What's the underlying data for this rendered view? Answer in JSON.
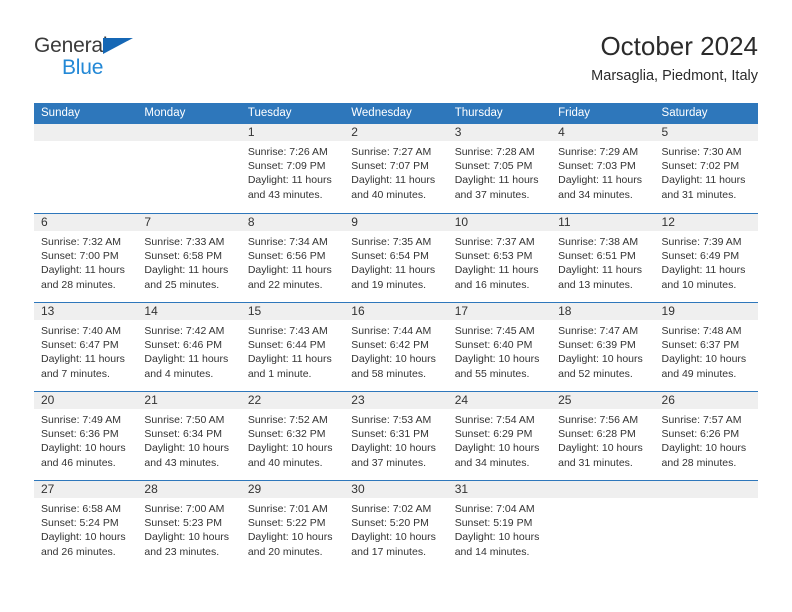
{
  "brand": {
    "name_part1": "General",
    "name_part2": "Blue",
    "triangle_color": "#1567b5",
    "blue_color": "#2388d6"
  },
  "header": {
    "title": "October 2024",
    "subtitle": "Marsaglia, Piedmont, Italy"
  },
  "theme": {
    "header_blue": "#2e77bb",
    "day_band_gray": "#efefef",
    "text": "#333333"
  },
  "calendar": {
    "weekday_headers": [
      "Sunday",
      "Monday",
      "Tuesday",
      "Wednesday",
      "Thursday",
      "Friday",
      "Saturday"
    ],
    "weeks": [
      [
        {
          "day": "",
          "lines": []
        },
        {
          "day": "",
          "lines": []
        },
        {
          "day": "1",
          "lines": [
            "Sunrise: 7:26 AM",
            "Sunset: 7:09 PM",
            "Daylight: 11 hours",
            "and 43 minutes."
          ]
        },
        {
          "day": "2",
          "lines": [
            "Sunrise: 7:27 AM",
            "Sunset: 7:07 PM",
            "Daylight: 11 hours",
            "and 40 minutes."
          ]
        },
        {
          "day": "3",
          "lines": [
            "Sunrise: 7:28 AM",
            "Sunset: 7:05 PM",
            "Daylight: 11 hours",
            "and 37 minutes."
          ]
        },
        {
          "day": "4",
          "lines": [
            "Sunrise: 7:29 AM",
            "Sunset: 7:03 PM",
            "Daylight: 11 hours",
            "and 34 minutes."
          ]
        },
        {
          "day": "5",
          "lines": [
            "Sunrise: 7:30 AM",
            "Sunset: 7:02 PM",
            "Daylight: 11 hours",
            "and 31 minutes."
          ]
        }
      ],
      [
        {
          "day": "6",
          "lines": [
            "Sunrise: 7:32 AM",
            "Sunset: 7:00 PM",
            "Daylight: 11 hours",
            "and 28 minutes."
          ]
        },
        {
          "day": "7",
          "lines": [
            "Sunrise: 7:33 AM",
            "Sunset: 6:58 PM",
            "Daylight: 11 hours",
            "and 25 minutes."
          ]
        },
        {
          "day": "8",
          "lines": [
            "Sunrise: 7:34 AM",
            "Sunset: 6:56 PM",
            "Daylight: 11 hours",
            "and 22 minutes."
          ]
        },
        {
          "day": "9",
          "lines": [
            "Sunrise: 7:35 AM",
            "Sunset: 6:54 PM",
            "Daylight: 11 hours",
            "and 19 minutes."
          ]
        },
        {
          "day": "10",
          "lines": [
            "Sunrise: 7:37 AM",
            "Sunset: 6:53 PM",
            "Daylight: 11 hours",
            "and 16 minutes."
          ]
        },
        {
          "day": "11",
          "lines": [
            "Sunrise: 7:38 AM",
            "Sunset: 6:51 PM",
            "Daylight: 11 hours",
            "and 13 minutes."
          ]
        },
        {
          "day": "12",
          "lines": [
            "Sunrise: 7:39 AM",
            "Sunset: 6:49 PM",
            "Daylight: 11 hours",
            "and 10 minutes."
          ]
        }
      ],
      [
        {
          "day": "13",
          "lines": [
            "Sunrise: 7:40 AM",
            "Sunset: 6:47 PM",
            "Daylight: 11 hours",
            "and 7 minutes."
          ]
        },
        {
          "day": "14",
          "lines": [
            "Sunrise: 7:42 AM",
            "Sunset: 6:46 PM",
            "Daylight: 11 hours",
            "and 4 minutes."
          ]
        },
        {
          "day": "15",
          "lines": [
            "Sunrise: 7:43 AM",
            "Sunset: 6:44 PM",
            "Daylight: 11 hours",
            "and 1 minute."
          ]
        },
        {
          "day": "16",
          "lines": [
            "Sunrise: 7:44 AM",
            "Sunset: 6:42 PM",
            "Daylight: 10 hours",
            "and 58 minutes."
          ]
        },
        {
          "day": "17",
          "lines": [
            "Sunrise: 7:45 AM",
            "Sunset: 6:40 PM",
            "Daylight: 10 hours",
            "and 55 minutes."
          ]
        },
        {
          "day": "18",
          "lines": [
            "Sunrise: 7:47 AM",
            "Sunset: 6:39 PM",
            "Daylight: 10 hours",
            "and 52 minutes."
          ]
        },
        {
          "day": "19",
          "lines": [
            "Sunrise: 7:48 AM",
            "Sunset: 6:37 PM",
            "Daylight: 10 hours",
            "and 49 minutes."
          ]
        }
      ],
      [
        {
          "day": "20",
          "lines": [
            "Sunrise: 7:49 AM",
            "Sunset: 6:36 PM",
            "Daylight: 10 hours",
            "and 46 minutes."
          ]
        },
        {
          "day": "21",
          "lines": [
            "Sunrise: 7:50 AM",
            "Sunset: 6:34 PM",
            "Daylight: 10 hours",
            "and 43 minutes."
          ]
        },
        {
          "day": "22",
          "lines": [
            "Sunrise: 7:52 AM",
            "Sunset: 6:32 PM",
            "Daylight: 10 hours",
            "and 40 minutes."
          ]
        },
        {
          "day": "23",
          "lines": [
            "Sunrise: 7:53 AM",
            "Sunset: 6:31 PM",
            "Daylight: 10 hours",
            "and 37 minutes."
          ]
        },
        {
          "day": "24",
          "lines": [
            "Sunrise: 7:54 AM",
            "Sunset: 6:29 PM",
            "Daylight: 10 hours",
            "and 34 minutes."
          ]
        },
        {
          "day": "25",
          "lines": [
            "Sunrise: 7:56 AM",
            "Sunset: 6:28 PM",
            "Daylight: 10 hours",
            "and 31 minutes."
          ]
        },
        {
          "day": "26",
          "lines": [
            "Sunrise: 7:57 AM",
            "Sunset: 6:26 PM",
            "Daylight: 10 hours",
            "and 28 minutes."
          ]
        }
      ],
      [
        {
          "day": "27",
          "lines": [
            "Sunrise: 6:58 AM",
            "Sunset: 5:24 PM",
            "Daylight: 10 hours",
            "and 26 minutes."
          ]
        },
        {
          "day": "28",
          "lines": [
            "Sunrise: 7:00 AM",
            "Sunset: 5:23 PM",
            "Daylight: 10 hours",
            "and 23 minutes."
          ]
        },
        {
          "day": "29",
          "lines": [
            "Sunrise: 7:01 AM",
            "Sunset: 5:22 PM",
            "Daylight: 10 hours",
            "and 20 minutes."
          ]
        },
        {
          "day": "30",
          "lines": [
            "Sunrise: 7:02 AM",
            "Sunset: 5:20 PM",
            "Daylight: 10 hours",
            "and 17 minutes."
          ]
        },
        {
          "day": "31",
          "lines": [
            "Sunrise: 7:04 AM",
            "Sunset: 5:19 PM",
            "Daylight: 10 hours",
            "and 14 minutes."
          ]
        },
        {
          "day": "",
          "lines": []
        },
        {
          "day": "",
          "lines": []
        }
      ]
    ]
  }
}
